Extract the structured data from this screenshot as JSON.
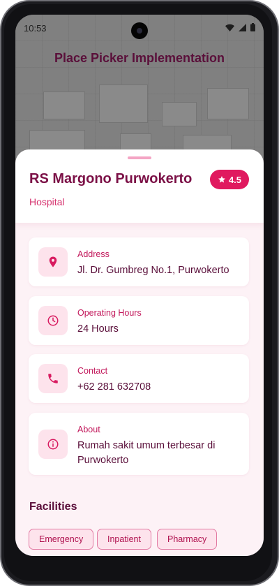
{
  "status_bar": {
    "time": "10:53"
  },
  "app_bar": {
    "title": "Place Picker Implementation"
  },
  "place": {
    "name": "RS Margono Purwokerto",
    "type": "Hospital",
    "rating": "4.5"
  },
  "details": [
    {
      "label": "Address",
      "value": "Jl. Dr. Gumbreg No.1, Purwokerto",
      "icon": "location-pin-icon"
    },
    {
      "label": "Operating Hours",
      "value": "24 Hours",
      "icon": "clock-icon"
    },
    {
      "label": "Contact",
      "value": "+62 281 632708",
      "icon": "phone-icon"
    },
    {
      "label": "About",
      "value": "Rumah sakit umum terbesar di Purwokerto",
      "icon": "info-icon"
    }
  ],
  "facilities": {
    "title": "Facilities",
    "items": [
      "Emergency",
      "Inpatient",
      "Pharmacy"
    ]
  },
  "colors": {
    "primary": "#e0195f",
    "text_dark": "#5a0f3a",
    "accent_light": "#fde3ec"
  }
}
